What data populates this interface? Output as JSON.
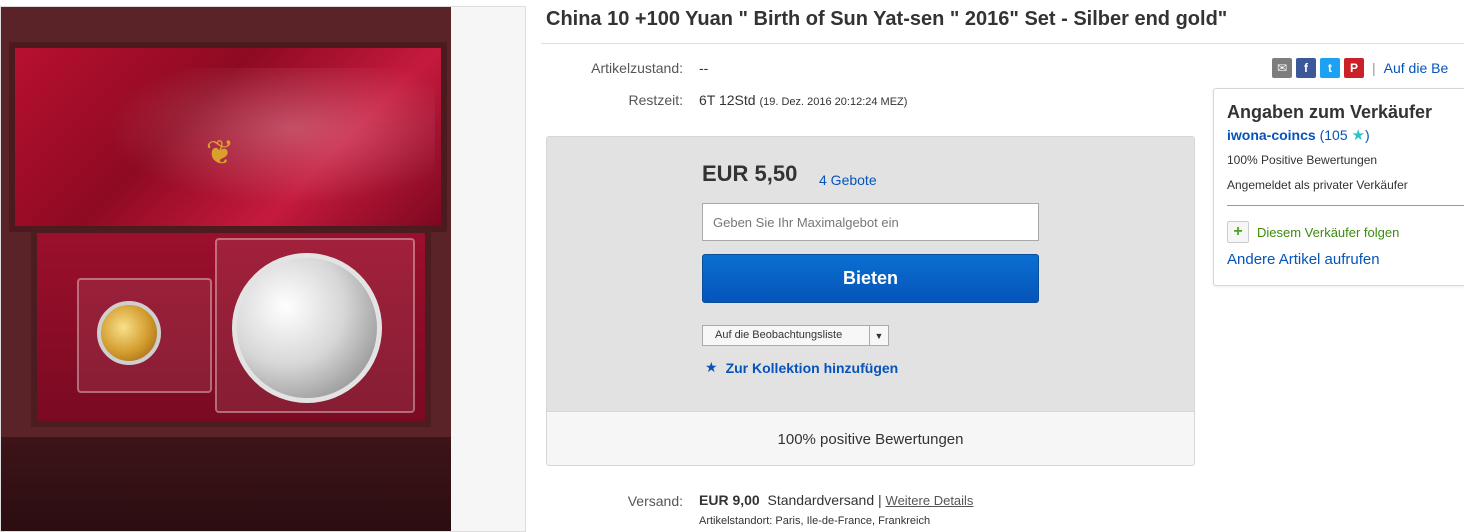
{
  "title": "China 10 +100 Yuan \" Birth of Sun Yat-sen \" 2016\" Set - Silber end gold\"",
  "specs": {
    "condition_label": "Artikelzustand:",
    "condition_value": "--",
    "time_label": "Restzeit:",
    "time_value": "6T 12Std",
    "time_detail": "(19. Dez. 2016  20:12:24 MEZ)"
  },
  "share": {
    "icons": [
      "email-icon",
      "facebook-icon",
      "twitter-icon",
      "pinterest-icon"
    ],
    "separator": "|",
    "link_text": "Auf die Be"
  },
  "bid": {
    "price": "EUR 5,50",
    "bid_count": "4 Gebote",
    "input_placeholder": "Geben Sie Ihr Maximalgebot ein",
    "button_label": "Bieten",
    "watchlist_label": "Auf die Beobachtungsliste",
    "collection_label": "Zur Kollektion hinzufügen",
    "feedback": "100% positive Bewertungen"
  },
  "shipping": {
    "label": "Versand:",
    "cost": "EUR 9,00",
    "method": "Standardversand |",
    "details_link": "Weitere Details",
    "location": "Artikelstandort:  Paris, Ile-de-France, Frankreich"
  },
  "seller": {
    "title": "Angaben zum Verkäufer",
    "name": "iwona-coincs",
    "score_open": "(",
    "score": "105",
    "score_close": ")",
    "positive": "100% Positive Bewertungen",
    "type": "Angemeldet als privater Verkäufer",
    "follow": "Diesem Verkäufer folgen",
    "other_items": "Andere Artikel aufrufen"
  },
  "colors": {
    "link_blue": "#0654ba",
    "follow_green": "#3d8b0f",
    "star_teal": "#2cc4c4"
  }
}
